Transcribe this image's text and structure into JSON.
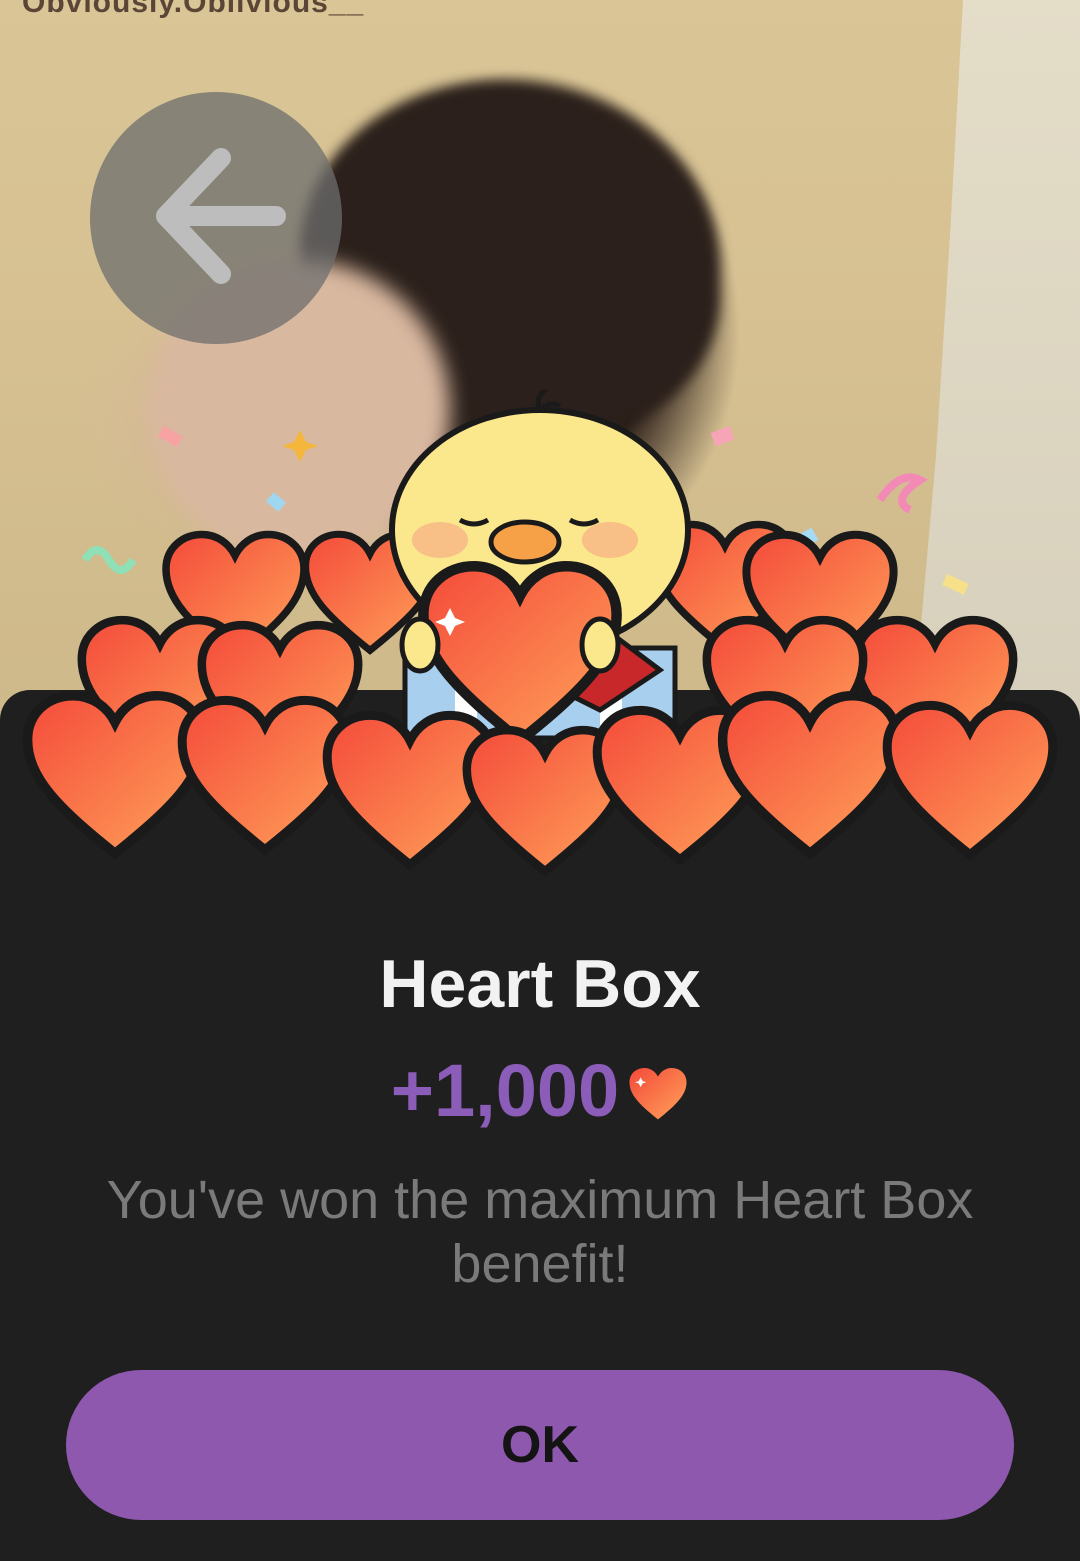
{
  "background": {
    "watermark": "Obviously.Oblivious__"
  },
  "back_button": {
    "icon": "arrow-left-icon"
  },
  "dialog": {
    "title": "Heart Box",
    "amount": "+1,000",
    "amount_icon": "heart-icon",
    "message": "You've won the maximum Heart Box benefit!",
    "ok_label": "OK"
  },
  "colors": {
    "accent": "#8e58ae",
    "amount_text": "#8b5cb8",
    "sheet_bg": "#1f1f1f",
    "heart": "#f2553f"
  }
}
